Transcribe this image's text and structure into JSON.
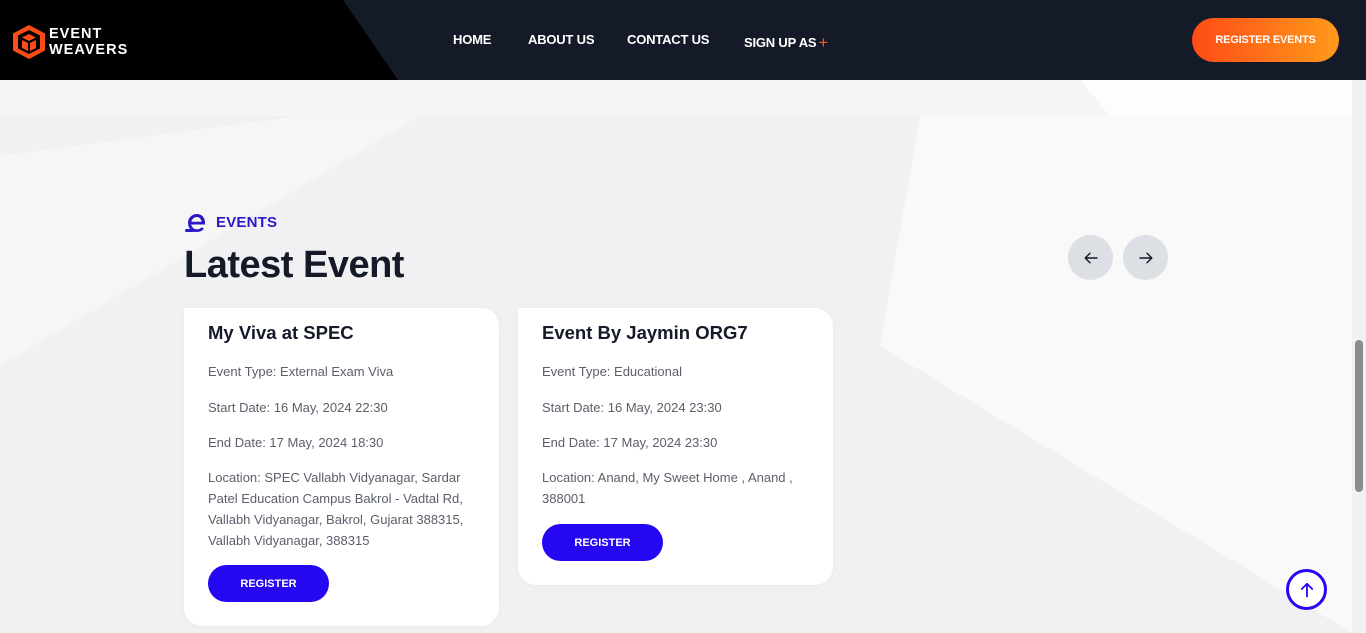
{
  "header": {
    "logo": {
      "line1": "EVENT",
      "line2": "WEAVERS"
    },
    "nav": [
      {
        "label": "HOME"
      },
      {
        "label": "ABOUT US"
      },
      {
        "label": "CONTACT US"
      },
      {
        "label": "SIGN UP AS",
        "suffix": "+"
      }
    ],
    "cta_label": "REGISTER EVENTS"
  },
  "section": {
    "eyebrow": "EVENTS",
    "title": "Latest Event"
  },
  "events": [
    {
      "title": "My Viva at SPEC",
      "type": "Event Type: External Exam Viva",
      "start": "Start Date: 16 May, 2024 22:30",
      "end": "End Date: 17 May, 2024 18:30",
      "location": "Location: SPEC Vallabh Vidyanagar, Sardar Patel Education Campus Bakrol - Vadtal Rd, Vallabh Vidyanagar, Bakrol, Gujarat 388315, Vallabh Vidyanagar, 388315",
      "button": "REGISTER"
    },
    {
      "title": "Event By Jaymin ORG7",
      "type": "Event Type: Educational",
      "start": "Start Date: 16 May, 2024 23:30",
      "end": "End Date: 17 May, 2024 23:30",
      "location": "Location: Anand, My Sweet Home , Anand , 388001",
      "button": "REGISTER"
    }
  ],
  "colors": {
    "header_bg": "#151a28",
    "accent_blue": "#2607f2",
    "accent_orange": "#ff5722"
  },
  "icons": {
    "logo": "cube-logo-icon",
    "eyebrow": "e-letter-icon",
    "prev": "arrow-left-icon",
    "next": "arrow-right-icon",
    "to_top": "arrow-up-icon"
  }
}
